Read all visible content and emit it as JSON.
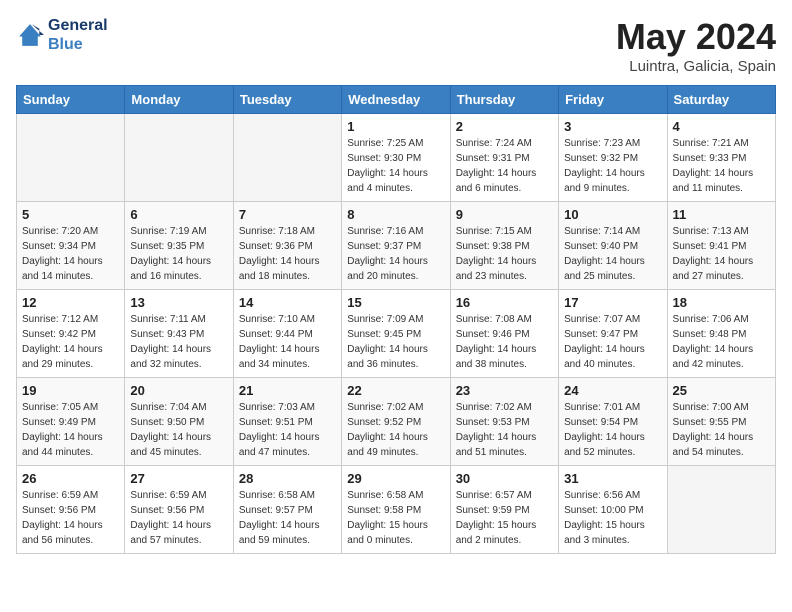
{
  "header": {
    "logo_line1": "General",
    "logo_line2": "Blue",
    "month": "May 2024",
    "location": "Luintra, Galicia, Spain"
  },
  "weekdays": [
    "Sunday",
    "Monday",
    "Tuesday",
    "Wednesday",
    "Thursday",
    "Friday",
    "Saturday"
  ],
  "weeks": [
    [
      {
        "day": "",
        "info": ""
      },
      {
        "day": "",
        "info": ""
      },
      {
        "day": "",
        "info": ""
      },
      {
        "day": "1",
        "info": "Sunrise: 7:25 AM\nSunset: 9:30 PM\nDaylight: 14 hours\nand 4 minutes."
      },
      {
        "day": "2",
        "info": "Sunrise: 7:24 AM\nSunset: 9:31 PM\nDaylight: 14 hours\nand 6 minutes."
      },
      {
        "day": "3",
        "info": "Sunrise: 7:23 AM\nSunset: 9:32 PM\nDaylight: 14 hours\nand 9 minutes."
      },
      {
        "day": "4",
        "info": "Sunrise: 7:21 AM\nSunset: 9:33 PM\nDaylight: 14 hours\nand 11 minutes."
      }
    ],
    [
      {
        "day": "5",
        "info": "Sunrise: 7:20 AM\nSunset: 9:34 PM\nDaylight: 14 hours\nand 14 minutes."
      },
      {
        "day": "6",
        "info": "Sunrise: 7:19 AM\nSunset: 9:35 PM\nDaylight: 14 hours\nand 16 minutes."
      },
      {
        "day": "7",
        "info": "Sunrise: 7:18 AM\nSunset: 9:36 PM\nDaylight: 14 hours\nand 18 minutes."
      },
      {
        "day": "8",
        "info": "Sunrise: 7:16 AM\nSunset: 9:37 PM\nDaylight: 14 hours\nand 20 minutes."
      },
      {
        "day": "9",
        "info": "Sunrise: 7:15 AM\nSunset: 9:38 PM\nDaylight: 14 hours\nand 23 minutes."
      },
      {
        "day": "10",
        "info": "Sunrise: 7:14 AM\nSunset: 9:40 PM\nDaylight: 14 hours\nand 25 minutes."
      },
      {
        "day": "11",
        "info": "Sunrise: 7:13 AM\nSunset: 9:41 PM\nDaylight: 14 hours\nand 27 minutes."
      }
    ],
    [
      {
        "day": "12",
        "info": "Sunrise: 7:12 AM\nSunset: 9:42 PM\nDaylight: 14 hours\nand 29 minutes."
      },
      {
        "day": "13",
        "info": "Sunrise: 7:11 AM\nSunset: 9:43 PM\nDaylight: 14 hours\nand 32 minutes."
      },
      {
        "day": "14",
        "info": "Sunrise: 7:10 AM\nSunset: 9:44 PM\nDaylight: 14 hours\nand 34 minutes."
      },
      {
        "day": "15",
        "info": "Sunrise: 7:09 AM\nSunset: 9:45 PM\nDaylight: 14 hours\nand 36 minutes."
      },
      {
        "day": "16",
        "info": "Sunrise: 7:08 AM\nSunset: 9:46 PM\nDaylight: 14 hours\nand 38 minutes."
      },
      {
        "day": "17",
        "info": "Sunrise: 7:07 AM\nSunset: 9:47 PM\nDaylight: 14 hours\nand 40 minutes."
      },
      {
        "day": "18",
        "info": "Sunrise: 7:06 AM\nSunset: 9:48 PM\nDaylight: 14 hours\nand 42 minutes."
      }
    ],
    [
      {
        "day": "19",
        "info": "Sunrise: 7:05 AM\nSunset: 9:49 PM\nDaylight: 14 hours\nand 44 minutes."
      },
      {
        "day": "20",
        "info": "Sunrise: 7:04 AM\nSunset: 9:50 PM\nDaylight: 14 hours\nand 45 minutes."
      },
      {
        "day": "21",
        "info": "Sunrise: 7:03 AM\nSunset: 9:51 PM\nDaylight: 14 hours\nand 47 minutes."
      },
      {
        "day": "22",
        "info": "Sunrise: 7:02 AM\nSunset: 9:52 PM\nDaylight: 14 hours\nand 49 minutes."
      },
      {
        "day": "23",
        "info": "Sunrise: 7:02 AM\nSunset: 9:53 PM\nDaylight: 14 hours\nand 51 minutes."
      },
      {
        "day": "24",
        "info": "Sunrise: 7:01 AM\nSunset: 9:54 PM\nDaylight: 14 hours\nand 52 minutes."
      },
      {
        "day": "25",
        "info": "Sunrise: 7:00 AM\nSunset: 9:55 PM\nDaylight: 14 hours\nand 54 minutes."
      }
    ],
    [
      {
        "day": "26",
        "info": "Sunrise: 6:59 AM\nSunset: 9:56 PM\nDaylight: 14 hours\nand 56 minutes."
      },
      {
        "day": "27",
        "info": "Sunrise: 6:59 AM\nSunset: 9:56 PM\nDaylight: 14 hours\nand 57 minutes."
      },
      {
        "day": "28",
        "info": "Sunrise: 6:58 AM\nSunset: 9:57 PM\nDaylight: 14 hours\nand 59 minutes."
      },
      {
        "day": "29",
        "info": "Sunrise: 6:58 AM\nSunset: 9:58 PM\nDaylight: 15 hours\nand 0 minutes."
      },
      {
        "day": "30",
        "info": "Sunrise: 6:57 AM\nSunset: 9:59 PM\nDaylight: 15 hours\nand 2 minutes."
      },
      {
        "day": "31",
        "info": "Sunrise: 6:56 AM\nSunset: 10:00 PM\nDaylight: 15 hours\nand 3 minutes."
      },
      {
        "day": "",
        "info": ""
      }
    ]
  ]
}
